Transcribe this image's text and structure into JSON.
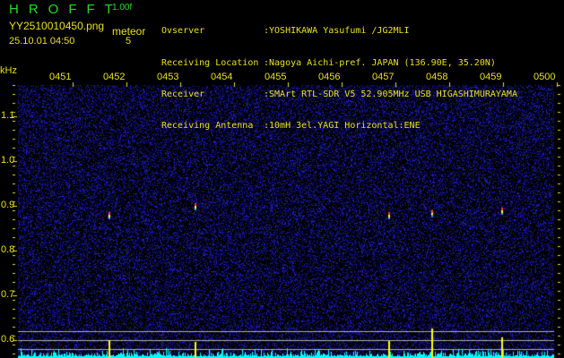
{
  "header": {
    "app_name": "HROFFT",
    "version": "1.00f",
    "filename": "YY2510010450.png",
    "datetime": "25.10.01 04:50",
    "meteor_label": "meteor",
    "meteor_count": "5",
    "info_labels": [
      "Ovserver",
      "Receiving Location",
      "Receiver",
      "Receiving Antenna"
    ],
    "info_values": [
      ":YOSHIKAWA Yasufumi /JG2MLI",
      ":Nagoya Aichi-pref. JAPAN (136.90E, 35.20N)",
      ":SMArt RTL-SDR V5 52.905MHz USB HIGASHIMURAYAMA",
      ":10mH 3el.YAGI Horizontal:ENE"
    ]
  },
  "chart_data": {
    "type": "heatmap",
    "title": "HROFFT spectrogram",
    "ylabel": "kHz",
    "x_ticks": [
      "0451",
      "0452",
      "0453",
      "0454",
      "0455",
      "0456",
      "0457",
      "0458",
      "0459",
      "0500"
    ],
    "y_ticks": [
      "1.1",
      "1.0",
      "0.9",
      "0.8",
      "0.7",
      "0.6"
    ],
    "ylim": [
      0.56,
      1.17
    ],
    "xlim_minutes": [
      0,
      10
    ],
    "echoes": [
      {
        "minute": 1.1,
        "freq": 0.88
      },
      {
        "minute": 2.7,
        "freq": 0.9
      },
      {
        "minute": 6.3,
        "freq": 0.88
      },
      {
        "minute": 7.1,
        "freq": 0.885
      },
      {
        "minute": 8.4,
        "freq": 0.89
      }
    ],
    "colors": {
      "background": "#000000",
      "noise": "#2020c0",
      "text": "#e8e020",
      "baseline": "#00ffff",
      "peak": "#ffff00",
      "guide": "#b0b0b0"
    }
  }
}
